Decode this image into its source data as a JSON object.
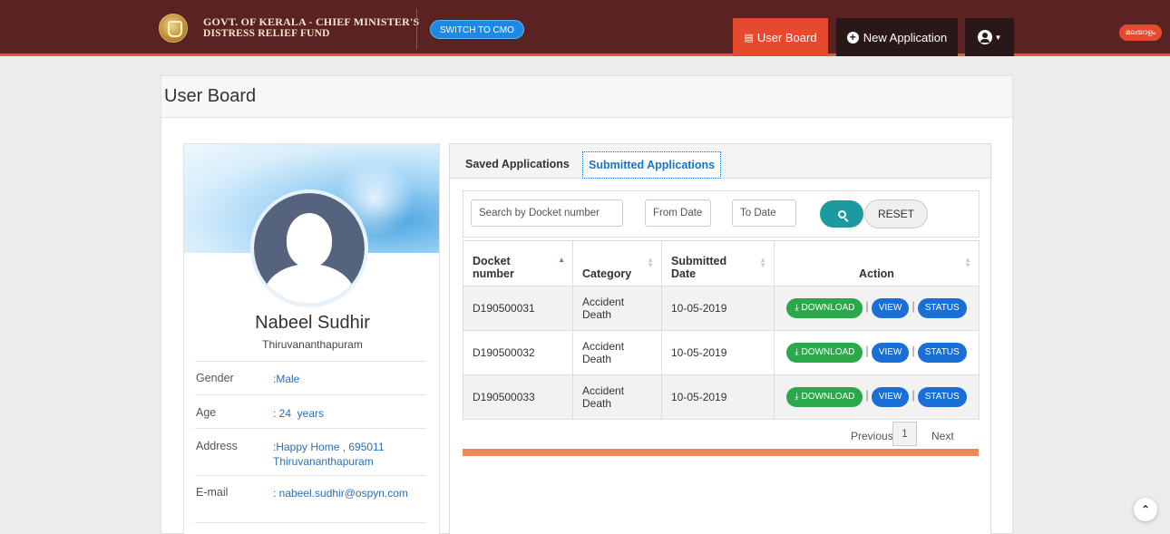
{
  "header": {
    "brand_line1": "GOVT. OF KERALA - CHIEF MINISTER'S",
    "brand_line2": "DISTRESS RELIEF FUND",
    "switch_label": "SWITCH TO CMO",
    "nav": {
      "user_board": "User Board",
      "new_application": "New Application"
    },
    "lang_label": "മലയാളം"
  },
  "page": {
    "title": "User Board"
  },
  "profile": {
    "name": "Nabeel Sudhir",
    "city": "Thiruvananthapuram",
    "fields": [
      {
        "label": "Gender",
        "value": ":Male"
      },
      {
        "label": "Age",
        "value": ": 24  years"
      },
      {
        "label": "Address",
        "value": ":Happy Home , 695011 Thiruvananthapuram"
      },
      {
        "label": "E-mail",
        "value": ": nabeel.sudhir@ospyn.com"
      }
    ]
  },
  "applications": {
    "tabs": {
      "saved": "Saved Applications",
      "submitted": "Submitted Applications"
    },
    "filter": {
      "docket_placeholder": "Search by Docket number",
      "from_placeholder": "From Date",
      "to_placeholder": "To Date",
      "reset_label": "RESET"
    },
    "columns": {
      "docket": "Docket number",
      "category": "Category",
      "submitted": "Submitted Date",
      "action": "Action"
    },
    "rows": [
      {
        "docket": "D190500031",
        "category": "Accident Death",
        "date": "10-05-2019"
      },
      {
        "docket": "D190500032",
        "category": "Accident Death",
        "date": "10-05-2019"
      },
      {
        "docket": "D190500033",
        "category": "Accident Death",
        "date": "10-05-2019"
      }
    ],
    "actions": {
      "download": "DOWNLOAD",
      "view": "VIEW",
      "status": "STATUS"
    },
    "pagination": {
      "previous": "Previous",
      "page": "1",
      "next": "Next"
    }
  }
}
